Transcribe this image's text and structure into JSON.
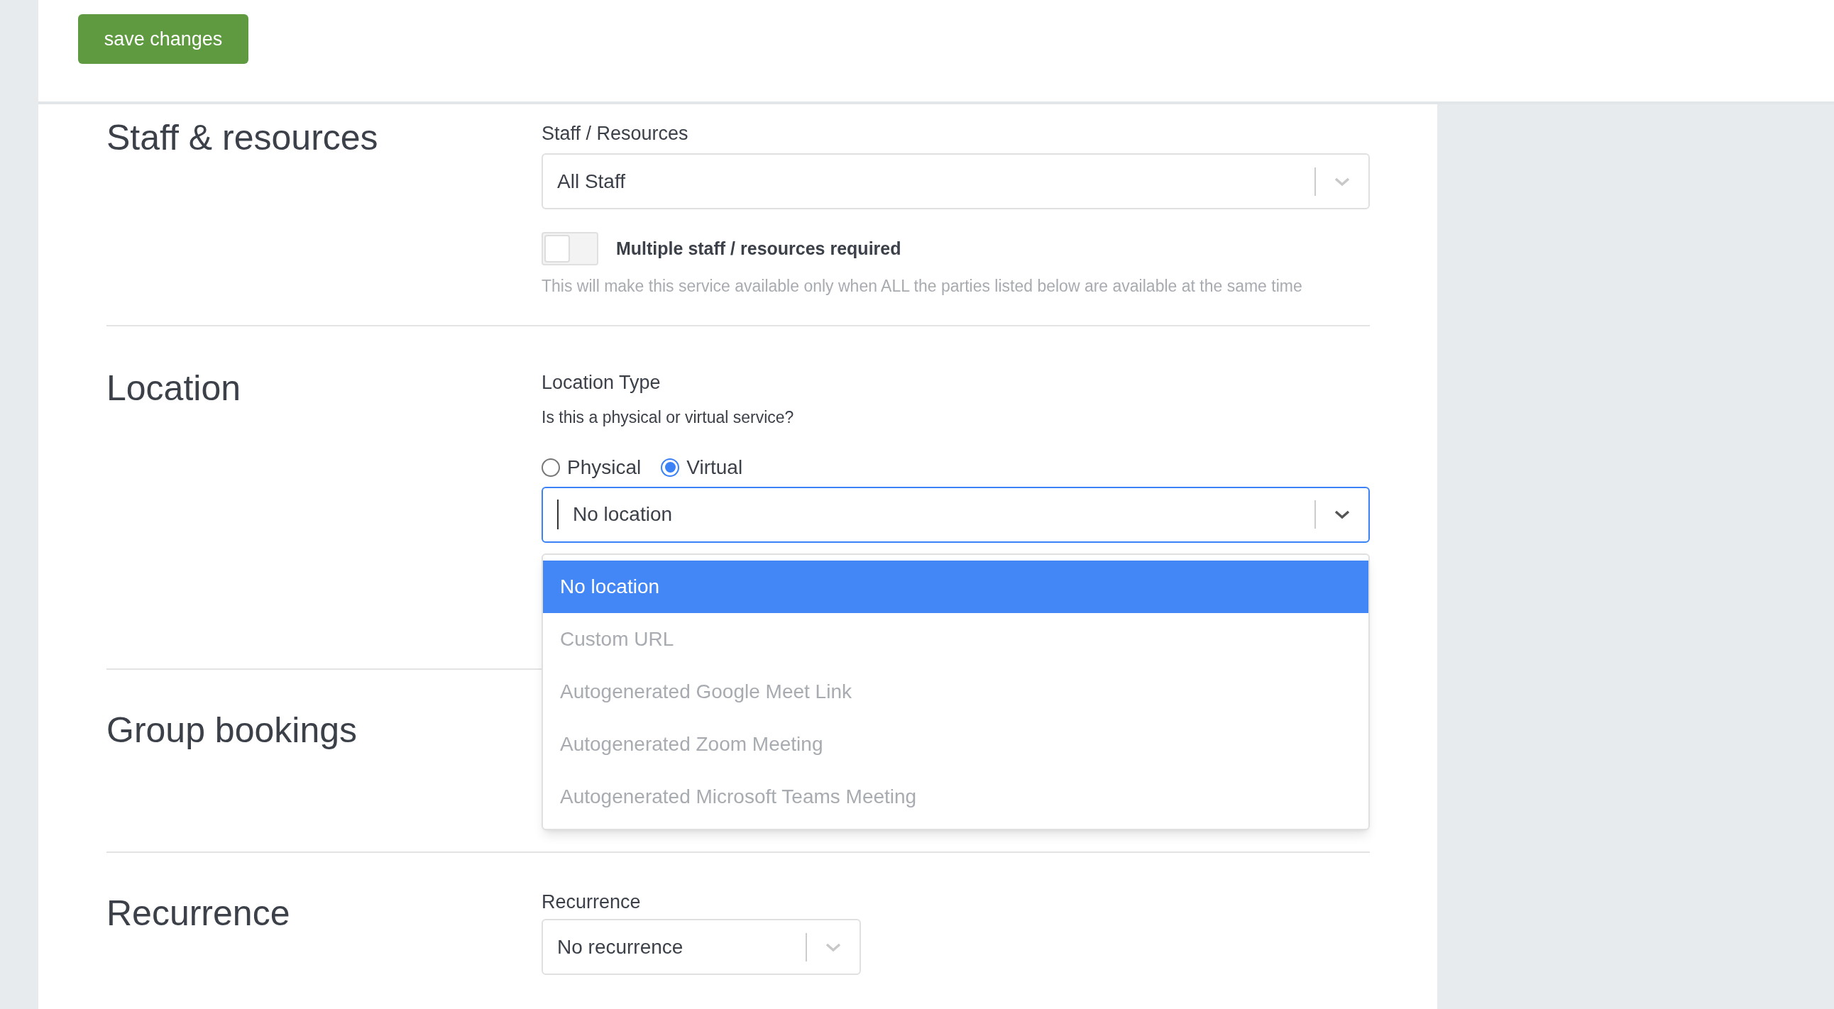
{
  "save_button": "save changes",
  "sections": [
    {
      "kind": "staff",
      "heading": "Staff & resources",
      "field_label": "Staff / Resources",
      "select_value": "All Staff",
      "toggle": {
        "label": "Multiple staff / resources required",
        "on": false
      },
      "help": "This will make this service available only when ALL the parties listed below are available at the same time"
    },
    {
      "kind": "location",
      "heading": "Location",
      "field_label": "Location Type",
      "question": "Is this a physical or virtual service?",
      "radios": [
        {
          "label": "Physical",
          "selected": false
        },
        {
          "label": "Virtual",
          "selected": true
        }
      ],
      "select_value": "No location",
      "expanded": true,
      "options": [
        {
          "label": "No location",
          "selected": true
        },
        {
          "label": "Custom URL",
          "selected": false
        },
        {
          "label": "Autogenerated Google Meet Link",
          "selected": false
        },
        {
          "label": "Autogenerated Zoom Meeting",
          "selected": false
        },
        {
          "label": "Autogenerated Microsoft Teams Meeting",
          "selected": false
        }
      ]
    },
    {
      "kind": "group",
      "heading": "Group bookings"
    },
    {
      "kind": "recurrence",
      "heading": "Recurrence",
      "field_label": "Recurrence",
      "select_value": "No recurrence"
    }
  ]
}
